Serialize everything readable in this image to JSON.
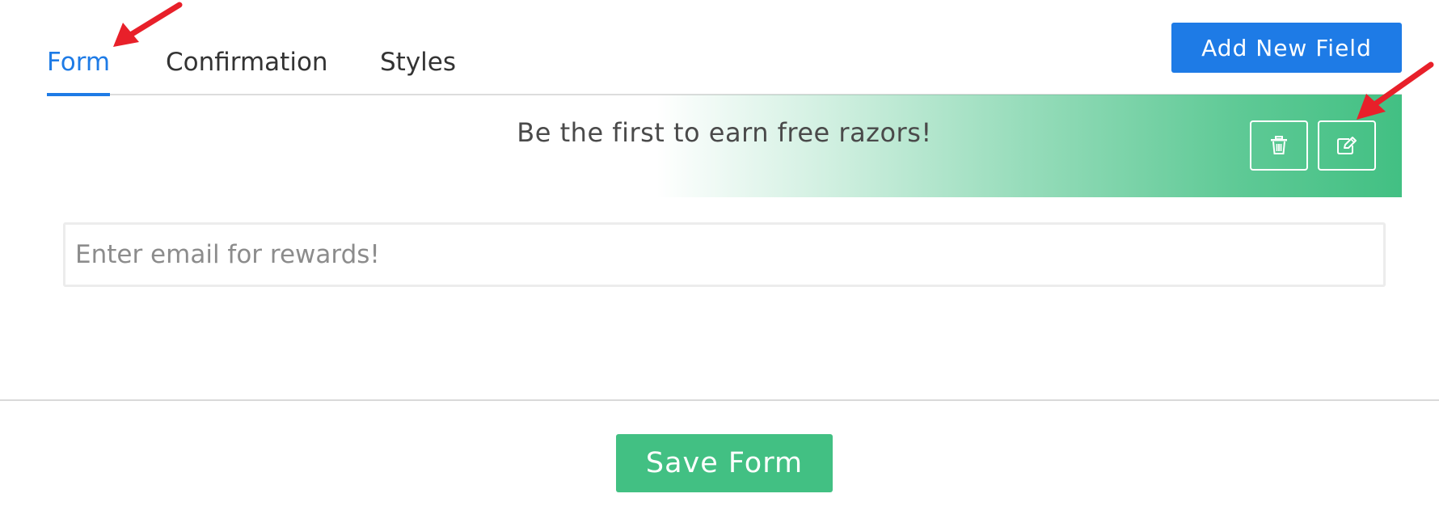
{
  "tabs": [
    {
      "label": "Form",
      "active": true
    },
    {
      "label": "Confirmation",
      "active": false
    },
    {
      "label": "Styles",
      "active": false
    }
  ],
  "toolbar": {
    "add_field_label": "Add New Field"
  },
  "field": {
    "header_text": "Be the first to earn free razors!",
    "delete_icon": "trash-icon",
    "edit_icon": "edit-icon"
  },
  "email_input": {
    "placeholder": "Enter email for rewards!",
    "value": ""
  },
  "footer": {
    "save_label": "Save Form"
  },
  "colors": {
    "accent_blue": "#1e7be6",
    "accent_green": "#42c083",
    "annotation_red": "#e8202a"
  }
}
